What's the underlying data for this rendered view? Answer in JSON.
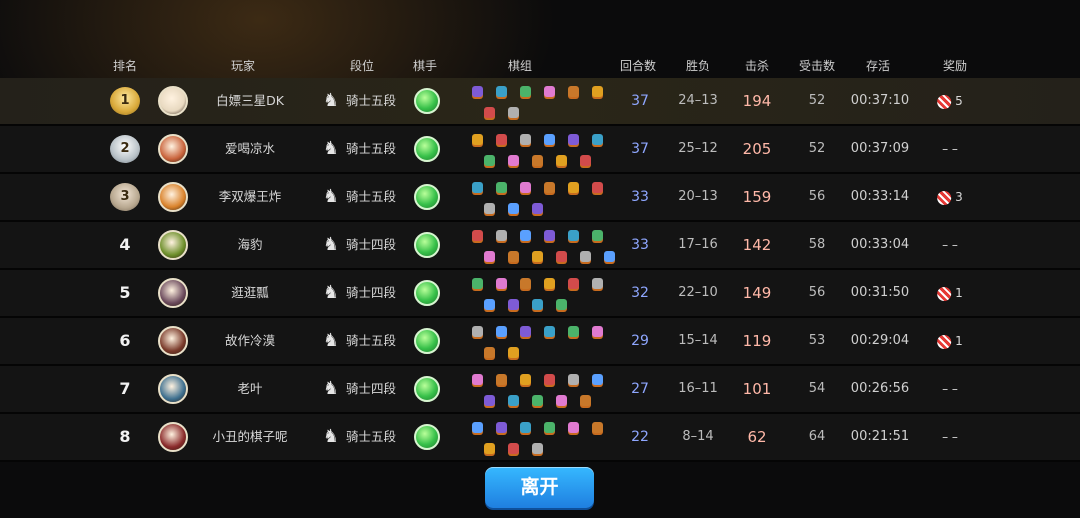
{
  "colors": {
    "accent_blue": "#2a9cf5",
    "kills": "#ffb8a8",
    "rounds": "#8fa7ff",
    "highlight_row": "#2a2618"
  },
  "header": {
    "rank": "排名",
    "player": "玩家",
    "tier": "段位",
    "chess_player": "棋手",
    "lineup": "棋组",
    "rounds": "回合数",
    "win_loss": "胜负",
    "kills": "击杀",
    "hits_taken": "受击数",
    "survival": "存活",
    "reward": "奖励"
  },
  "rows": [
    {
      "rank": "1",
      "trophy": "gold-trophy-icon",
      "name": "白嫖三星DK",
      "tier": "骑士五段",
      "rounds": "37",
      "wl": "24–13",
      "kills": "194",
      "hits": "52",
      "survival": "00:37:10",
      "reward_icon": "candy-icon",
      "reward": "5"
    },
    {
      "rank": "2",
      "trophy": "silver-trophy-icon",
      "name": "爱喝凉水",
      "tier": "骑士五段",
      "rounds": "37",
      "wl": "25–12",
      "kills": "205",
      "hits": "52",
      "survival": "00:37:09",
      "reward": "– –"
    },
    {
      "rank": "3",
      "trophy": "bronze-trophy-icon",
      "name": "李双爆王炸",
      "tier": "骑士五段",
      "rounds": "33",
      "wl": "20–13",
      "kills": "159",
      "hits": "56",
      "survival": "00:33:14",
      "reward_icon": "candy-icon",
      "reward": "3"
    },
    {
      "rank": "4",
      "name": "海豹",
      "tier": "骑士四段",
      "rounds": "33",
      "wl": "17–16",
      "kills": "142",
      "hits": "58",
      "survival": "00:33:04",
      "reward": "– –"
    },
    {
      "rank": "5",
      "name": "逛逛瓢",
      "tier": "骑士四段",
      "rounds": "32",
      "wl": "22–10",
      "kills": "149",
      "hits": "56",
      "survival": "00:31:50",
      "reward_icon": "candy-icon",
      "reward": "1"
    },
    {
      "rank": "6",
      "name": "故作冷漠",
      "tier": "骑士五段",
      "rounds": "29",
      "wl": "15–14",
      "kills": "119",
      "hits": "53",
      "survival": "00:29:04",
      "reward_icon": "candy-icon",
      "reward": "1"
    },
    {
      "rank": "7",
      "name": "老叶",
      "tier": "骑士四段",
      "rounds": "27",
      "wl": "16–11",
      "kills": "101",
      "hits": "54",
      "survival": "00:26:56",
      "reward": "– –"
    },
    {
      "rank": "8",
      "name": "小丑的棋子呢",
      "tier": "骑士五段",
      "rounds": "22",
      "wl": "8–14",
      "kills": "62",
      "hits": "64",
      "survival": "00:21:51",
      "reward": "– –"
    }
  ],
  "leave_button": "离开"
}
